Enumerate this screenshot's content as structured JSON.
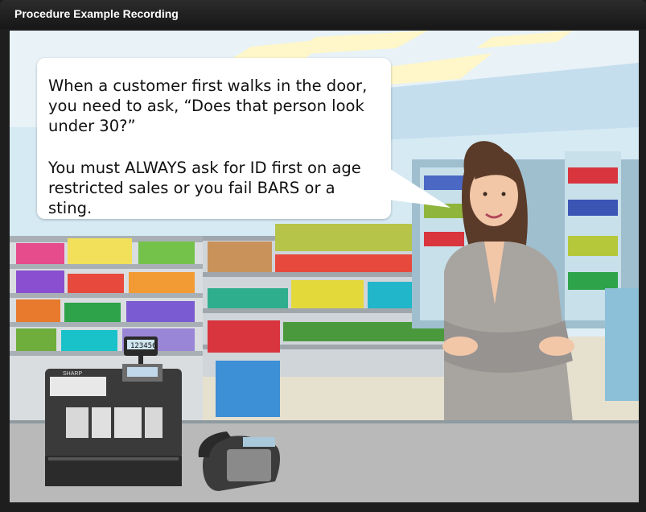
{
  "window": {
    "title": "Procedure Example Recording"
  },
  "slide": {
    "caption": {
      "paragraph1": "When a customer first walks in the door, you need to ask, “Does that person look under 30?”",
      "paragraph2": "You must ALWAYS ask for ID first on age restricted sales or you fail BARS or a sting."
    },
    "register": {
      "brand": "SHARP",
      "display_readout": "123456"
    }
  }
}
